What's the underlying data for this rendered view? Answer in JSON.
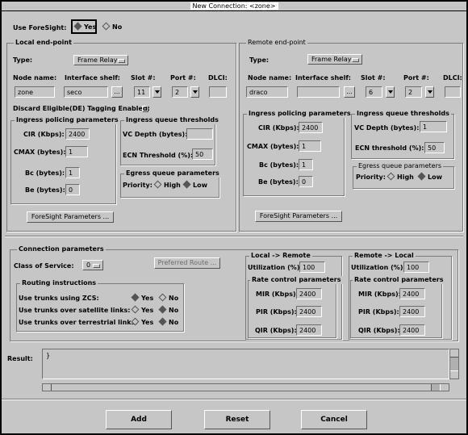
{
  "window": {
    "title": "New Connection: <zone>"
  },
  "foresight": {
    "label": "Use ForeSight:",
    "yes": "Yes",
    "no": "No"
  },
  "local": {
    "title": "Local end-point",
    "type_label": "Type:",
    "type_value": "Frame Relay",
    "node_label": "Node name:",
    "node_value": "zone",
    "shelf_label": "Interface shelf:",
    "shelf_value": "seco",
    "slot_label": "Slot #:",
    "slot_value": "11",
    "port_label": "Port #:",
    "port_value": "2",
    "dlci_label": "DLCI:",
    "dlci_value": "",
    "browse": "...",
    "discard": "Discard Eligible(DE) Tagging Enabled:",
    "policing": {
      "title": "Ingress policing parameters",
      "cir_label": "CIR (Kbps):",
      "cir_value": "2400",
      "cmax_label": "CMAX (bytes):",
      "cmax_value": "1",
      "bc_label": "Bc (bytes):",
      "bc_value": "1",
      "be_label": "Be (bytes):",
      "be_value": "0"
    },
    "queue": {
      "title": "Ingress queue thresholds",
      "vc_label": "VC Depth (bytes):",
      "vc_value": "",
      "ecn_label": "ECN Threshold (%):",
      "ecn_value": "50"
    },
    "egress": {
      "title": "Egress queue parameters",
      "priority_label": "Priority:",
      "high": "High",
      "low": "Low"
    },
    "fs_button": "ForeSight Parameters ..."
  },
  "remote": {
    "title": "Remote end-point",
    "type_label": "Type:",
    "type_value": "Frame Relay",
    "node_label": "Node name:",
    "node_value": "draco",
    "shelf_label": "Interface shelf:",
    "shelf_value": "",
    "slot_label": "Slot #:",
    "slot_value": "6",
    "port_label": "Port #:",
    "port_value": "2",
    "dlci_label": "DLCI:",
    "dlci_value": "",
    "browse": "...",
    "policing": {
      "title": "Ingress policing parameters",
      "cir_label": "CIR (Kbps):",
      "cir_value": "2400",
      "cmax_label": "CMAX (bytes):",
      "cmax_value": "1",
      "bc_label": "Bc (bytes):",
      "bc_value": "1",
      "be_label": "Be (bytes):",
      "be_value": "0"
    },
    "queue": {
      "title": "Ingress queue thresholds",
      "vc_label": "VC Depth (bytes):",
      "vc_value": "1",
      "ecn_label": "ECN threshold (%):",
      "ecn_value": "50"
    },
    "egress": {
      "title": "Egress queue parameters",
      "priority_label": "Priority:",
      "high": "High",
      "low": "Low"
    },
    "fs_button": "ForeSight Parameters ..."
  },
  "conn": {
    "title": "Connection parameters",
    "cos_label": "Class of Service:",
    "cos_value": "0",
    "pref_button": "Preferred Route ...",
    "routing": {
      "title": "Routing instructions",
      "zcs": "Use trunks using ZCS:",
      "satellite": "Use trunks over satellite links:",
      "terrestrial": "Use trunks over terrestrial links:",
      "yes": "Yes",
      "no": "No"
    },
    "l2r": {
      "title": "Local -> Remote",
      "util_label": "Utilization (%):",
      "util_value": "100",
      "rate_title": "Rate control parameters",
      "mir_label": "MIR (Kbps):",
      "mir_value": "2400",
      "pir_label": "PIR (Kbps):",
      "pir_value": "2400",
      "qir_label": "QIR (Kbps):",
      "qir_value": "2400"
    },
    "r2l": {
      "title": "Remote -> Local",
      "util_label": "Utilization (%):",
      "util_value": "100",
      "rate_title": "Rate control parameters",
      "mir_label": "MIR (Kbps):",
      "mir_value": "2400",
      "pir_label": "PIR (Kbps):",
      "pir_value": "2400",
      "qir_label": "QIR (Kbps):",
      "qir_value": "2400"
    }
  },
  "result": {
    "label": "Result:",
    "value": "}"
  },
  "buttons": {
    "add": "Add",
    "reset": "Reset",
    "cancel": "Cancel"
  }
}
